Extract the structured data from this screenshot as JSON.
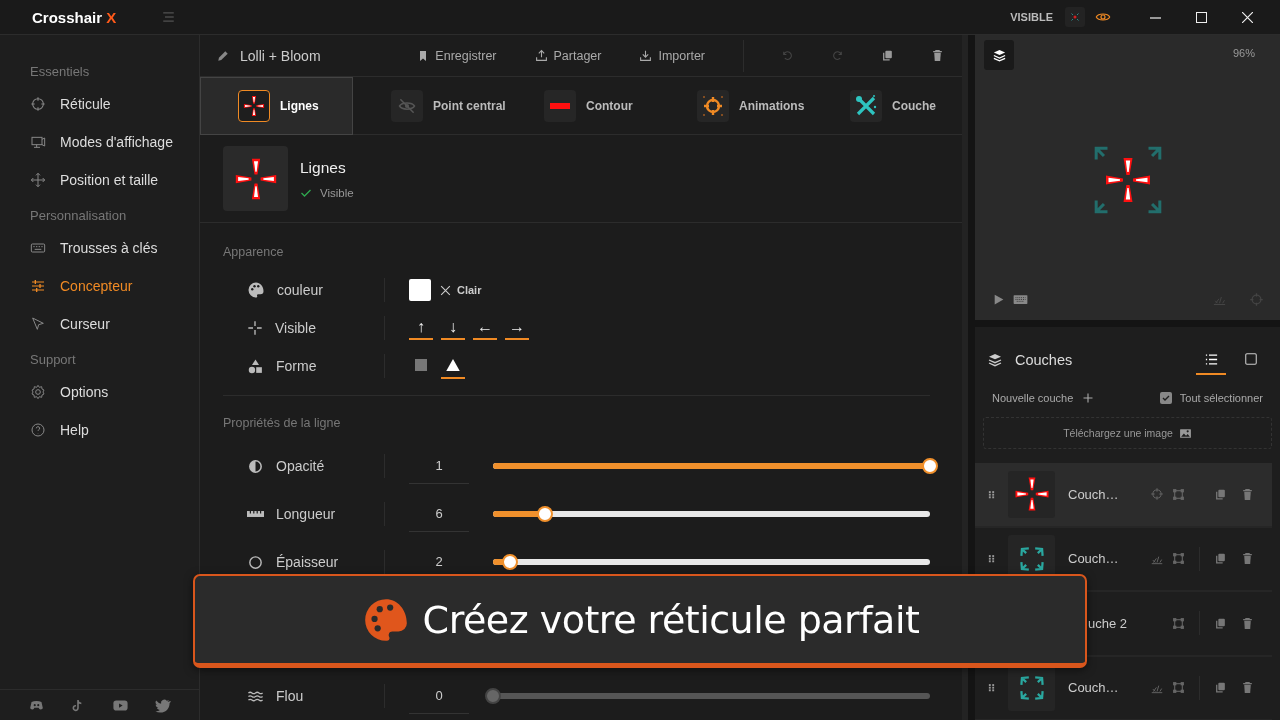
{
  "app": {
    "name": "Crosshair",
    "mark": "X",
    "status": "VISIBLE"
  },
  "sidebar": {
    "sections": [
      {
        "title": "Essentiels",
        "items": [
          {
            "label": "Réticule",
            "kind": "reticle",
            "selected": false
          },
          {
            "label": "Modes d'affichage",
            "kind": "display",
            "selected": false
          },
          {
            "label": "Position et taille",
            "kind": "move",
            "selected": false
          }
        ]
      },
      {
        "title": "Personnalisation",
        "items": [
          {
            "label": "Trousses à clés",
            "kind": "keys",
            "selected": false
          },
          {
            "label": "Concepteur",
            "kind": "designer",
            "selected": true
          },
          {
            "label": "Curseur",
            "kind": "cursor",
            "selected": false
          }
        ]
      },
      {
        "title": "Support",
        "items": [
          {
            "label": "Options",
            "kind": "gear",
            "selected": false
          },
          {
            "label": "Help",
            "kind": "help",
            "selected": false
          }
        ]
      }
    ]
  },
  "editor": {
    "profile_name": "Lolli + Bloom",
    "actions": [
      {
        "label": "Enregistrer",
        "kind": "save"
      },
      {
        "label": "Partager",
        "kind": "share"
      },
      {
        "label": "Importer",
        "kind": "import"
      }
    ],
    "tools": [
      {
        "kind": "undo",
        "disabled": true
      },
      {
        "kind": "redo",
        "disabled": true
      },
      {
        "kind": "copy",
        "disabled": false
      },
      {
        "kind": "delete",
        "disabled": false
      }
    ],
    "tabs": [
      {
        "label": "Lignes",
        "kind": "lines",
        "selected": true
      },
      {
        "label": "Point central",
        "kind": "center",
        "selected": false
      },
      {
        "label": "Contour",
        "kind": "outline",
        "selected": false
      },
      {
        "label": "Animations",
        "kind": "animation",
        "selected": false
      },
      {
        "label": "Couche",
        "kind": "layer",
        "selected": false
      }
    ],
    "element": {
      "title": "Lignes",
      "status": "Visible"
    },
    "appearance": {
      "title": "Apparence",
      "color": {
        "label": "couleur",
        "color": "#ffffff",
        "clear": "Clair"
      },
      "visible": {
        "label": "Visible",
        "directions": [
          {
            "symbol": "↑",
            "on": true
          },
          {
            "symbol": "↓",
            "on": true
          },
          {
            "symbol": "←",
            "on": true
          },
          {
            "symbol": "→",
            "on": true
          }
        ]
      },
      "shape": {
        "label": "Forme",
        "options": [
          {
            "kind": "square",
            "selected": false
          },
          {
            "kind": "triangle",
            "selected": true
          }
        ]
      }
    },
    "properties": {
      "title": "Propriétés de la ligne",
      "sliders": [
        {
          "label": "Opacité",
          "kind": "opacity",
          "value": "1",
          "level": 1,
          "disabled": false
        },
        {
          "label": "Longueur",
          "kind": "length",
          "value": "6",
          "level": 0.12,
          "disabled": false
        },
        {
          "label": "Épaisseur",
          "kind": "thickness",
          "value": "2",
          "level": 0.04,
          "disabled": false
        },
        {
          "label": "Flou",
          "kind": "blur",
          "value": "0",
          "level": 0,
          "disabled": true
        }
      ]
    }
  },
  "preview": {
    "zoom": "96%"
  },
  "layers": {
    "title": "Couches",
    "views": [
      {
        "kind": "list",
        "selected": true
      },
      {
        "kind": "grid",
        "selected": false
      }
    ],
    "new_layer": "Nouvelle couche",
    "select_all": {
      "label": "Tout sélectionner",
      "checked": true
    },
    "upload": "Téléchargez une image",
    "items": [
      {
        "name": "Couch…",
        "kind": "crosshair",
        "selected": true
      },
      {
        "name": "Couch…",
        "kind": "effect",
        "selected": false
      },
      {
        "name": "uche 2",
        "kind": "image",
        "selected": false
      },
      {
        "name": "Couch…",
        "kind": "effect",
        "selected": false
      }
    ]
  },
  "banner": {
    "text": "Créez votre réticule parfait"
  }
}
